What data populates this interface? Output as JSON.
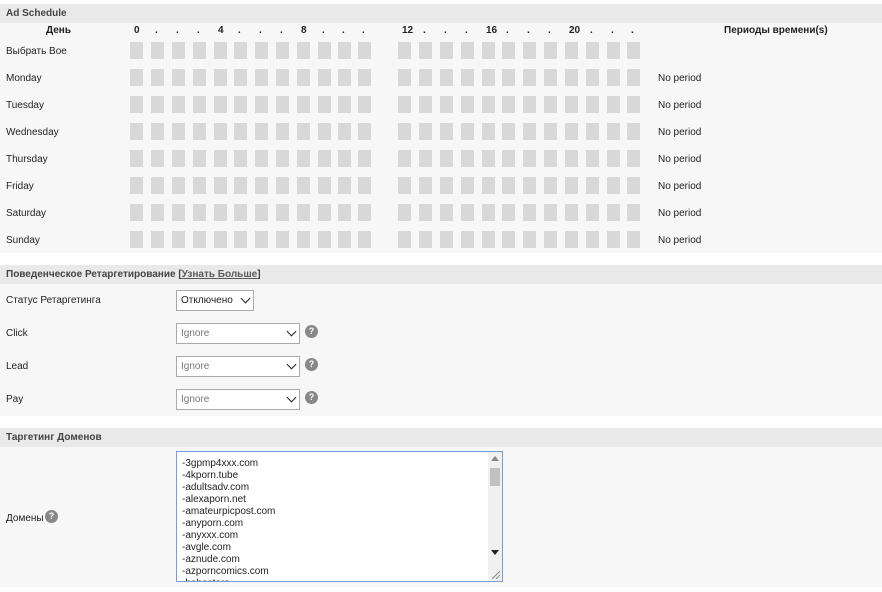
{
  "schedule": {
    "title": "Ad Schedule",
    "col_day": "День",
    "col_periods": "Периоды времени(s)",
    "hour_labels": [
      "0",
      "4",
      "8",
      "12",
      "16",
      "20"
    ],
    "dot": ".",
    "select_all": "Выбрать Вое",
    "days": [
      "Monday",
      "Tuesday",
      "Wednesday",
      "Thursday",
      "Friday",
      "Saturday",
      "Sunday"
    ],
    "no_period": "No period",
    "cell_color": "#d8d8d8"
  },
  "retargeting": {
    "title_prefix": "Поведенческое Ретаргетирование [",
    "learn_more": "Узнать Больше",
    "title_suffix": "]",
    "status_label": "Статус Ретаргетинга",
    "status_value": "Отключено",
    "click_label": "Click",
    "click_value": "Ignore",
    "lead_label": "Lead",
    "lead_value": "Ignore",
    "pay_label": "Pay",
    "pay_value": "Ignore",
    "help_glyph": "?"
  },
  "domains": {
    "title": "Таргетинг Доменов",
    "label": "Домены",
    "help_glyph": "?",
    "list": [
      "-3gpmp4xxx.com",
      "-4kporn.tube",
      "-adultsadv.com",
      "-alexaporn.net",
      "-amateurpicpost.com",
      "-anyporn.com",
      "-anyxxx.com",
      "-avgle.com",
      "-aznude.com",
      "-azporncomics.com",
      "-babestare"
    ]
  }
}
